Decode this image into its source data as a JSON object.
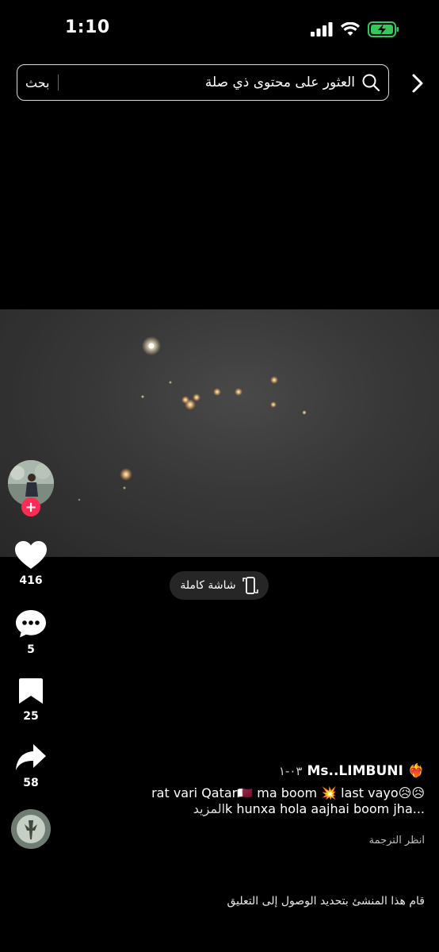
{
  "status_bar": {
    "time": "1:10"
  },
  "search": {
    "placeholder": "العثور على محتوى ذي صلة",
    "button": "بحث"
  },
  "fullscreen": {
    "label": "شاشة كاملة"
  },
  "actions": {
    "likes": "416",
    "comments": "5",
    "saves": "25",
    "shares": "58"
  },
  "caption": {
    "username": "Ms..LIMBUNI",
    "date": "٠٣-١",
    "line1": "rat vari Qatar🇶🇦 ma boom 💥 last vayo😥😥",
    "line2": "k hunxa hola aajhai boom jha...",
    "more": "المزيد",
    "translate": "انظر الترجمة"
  },
  "notice": "قام هذا المنشئ بتحديد الوصول إلى التعليق",
  "colors": {
    "background": "#000000",
    "follow": "#fe2c55",
    "battery": "#34c759"
  }
}
